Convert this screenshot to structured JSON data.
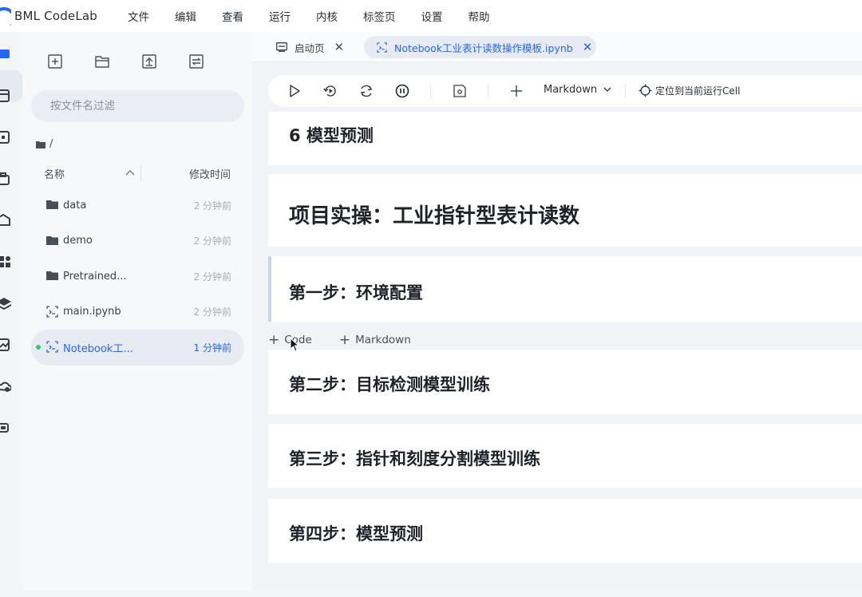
{
  "app": {
    "title": "BML CodeLab",
    "accent": "#2468f2"
  },
  "menu": [
    "文件",
    "编辑",
    "查看",
    "运行",
    "内核",
    "标签页",
    "设置",
    "帮助"
  ],
  "activity_icons": [
    "folder-icon",
    "browser-icon",
    "terminal-icon",
    "toolbox-icon",
    "mail-icon",
    "apps-icon",
    "layers-icon",
    "chart-icon",
    "cloud-icon",
    "chip-icon"
  ],
  "file_panel": {
    "filter_placeholder": "按文件名过滤",
    "breadcrumb": "/",
    "col_name": "名称",
    "col_time": "修改时间",
    "files": [
      {
        "name": "data",
        "type": "folder",
        "time": "2 分钟前"
      },
      {
        "name": "demo",
        "type": "folder",
        "time": "2 分钟前"
      },
      {
        "name": "Pretrained...",
        "type": "folder",
        "time": "2 分钟前"
      },
      {
        "name": "main.ipynb",
        "type": "notebook",
        "time": "2 分钟前"
      },
      {
        "name": "Notebook工...",
        "type": "notebook",
        "time": "1 分钟前",
        "active": true,
        "running": true
      }
    ]
  },
  "tabs": [
    {
      "label": "启动页",
      "icon": "launcher-icon"
    },
    {
      "label": "Notebook工业表计读数操作模板.ipynb",
      "icon": "notebook-icon",
      "active": true
    }
  ],
  "toolbar": {
    "cell_type": "Markdown",
    "locate_label": "定位到当前运行Cell"
  },
  "cells": [
    {
      "text": "6 模型预测"
    },
    {
      "text": "项目实操：工业指针型表计读数"
    },
    {
      "text": "第一步：环境配置"
    },
    {
      "text": "第二步：目标检测模型训练"
    },
    {
      "text": "第三步：指针和刻度分割模型训练"
    },
    {
      "text": "第四步：模型预测"
    }
  ],
  "add_cell": {
    "code": "Code",
    "markdown": "Markdown"
  }
}
